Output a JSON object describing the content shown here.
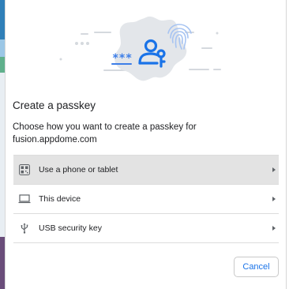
{
  "dialog": {
    "title": "Create a passkey",
    "description": "Choose how you want to create a passkey for fusion.appdome.com",
    "options": [
      {
        "label": "Use a phone or tablet",
        "icon": "qr-code-icon",
        "selected": true
      },
      {
        "label": "This device",
        "icon": "laptop-icon",
        "selected": false
      },
      {
        "label": "USB security key",
        "icon": "usb-icon",
        "selected": false
      }
    ],
    "illustration": {
      "password_mask": "***",
      "icons": [
        "user-key-icon",
        "fingerprint-icon"
      ]
    },
    "cancel_label": "Cancel"
  },
  "colors": {
    "accent": "#1a73e8",
    "illustration_blob": "#e3e6ea",
    "selected_row": "#e3e3e3"
  }
}
